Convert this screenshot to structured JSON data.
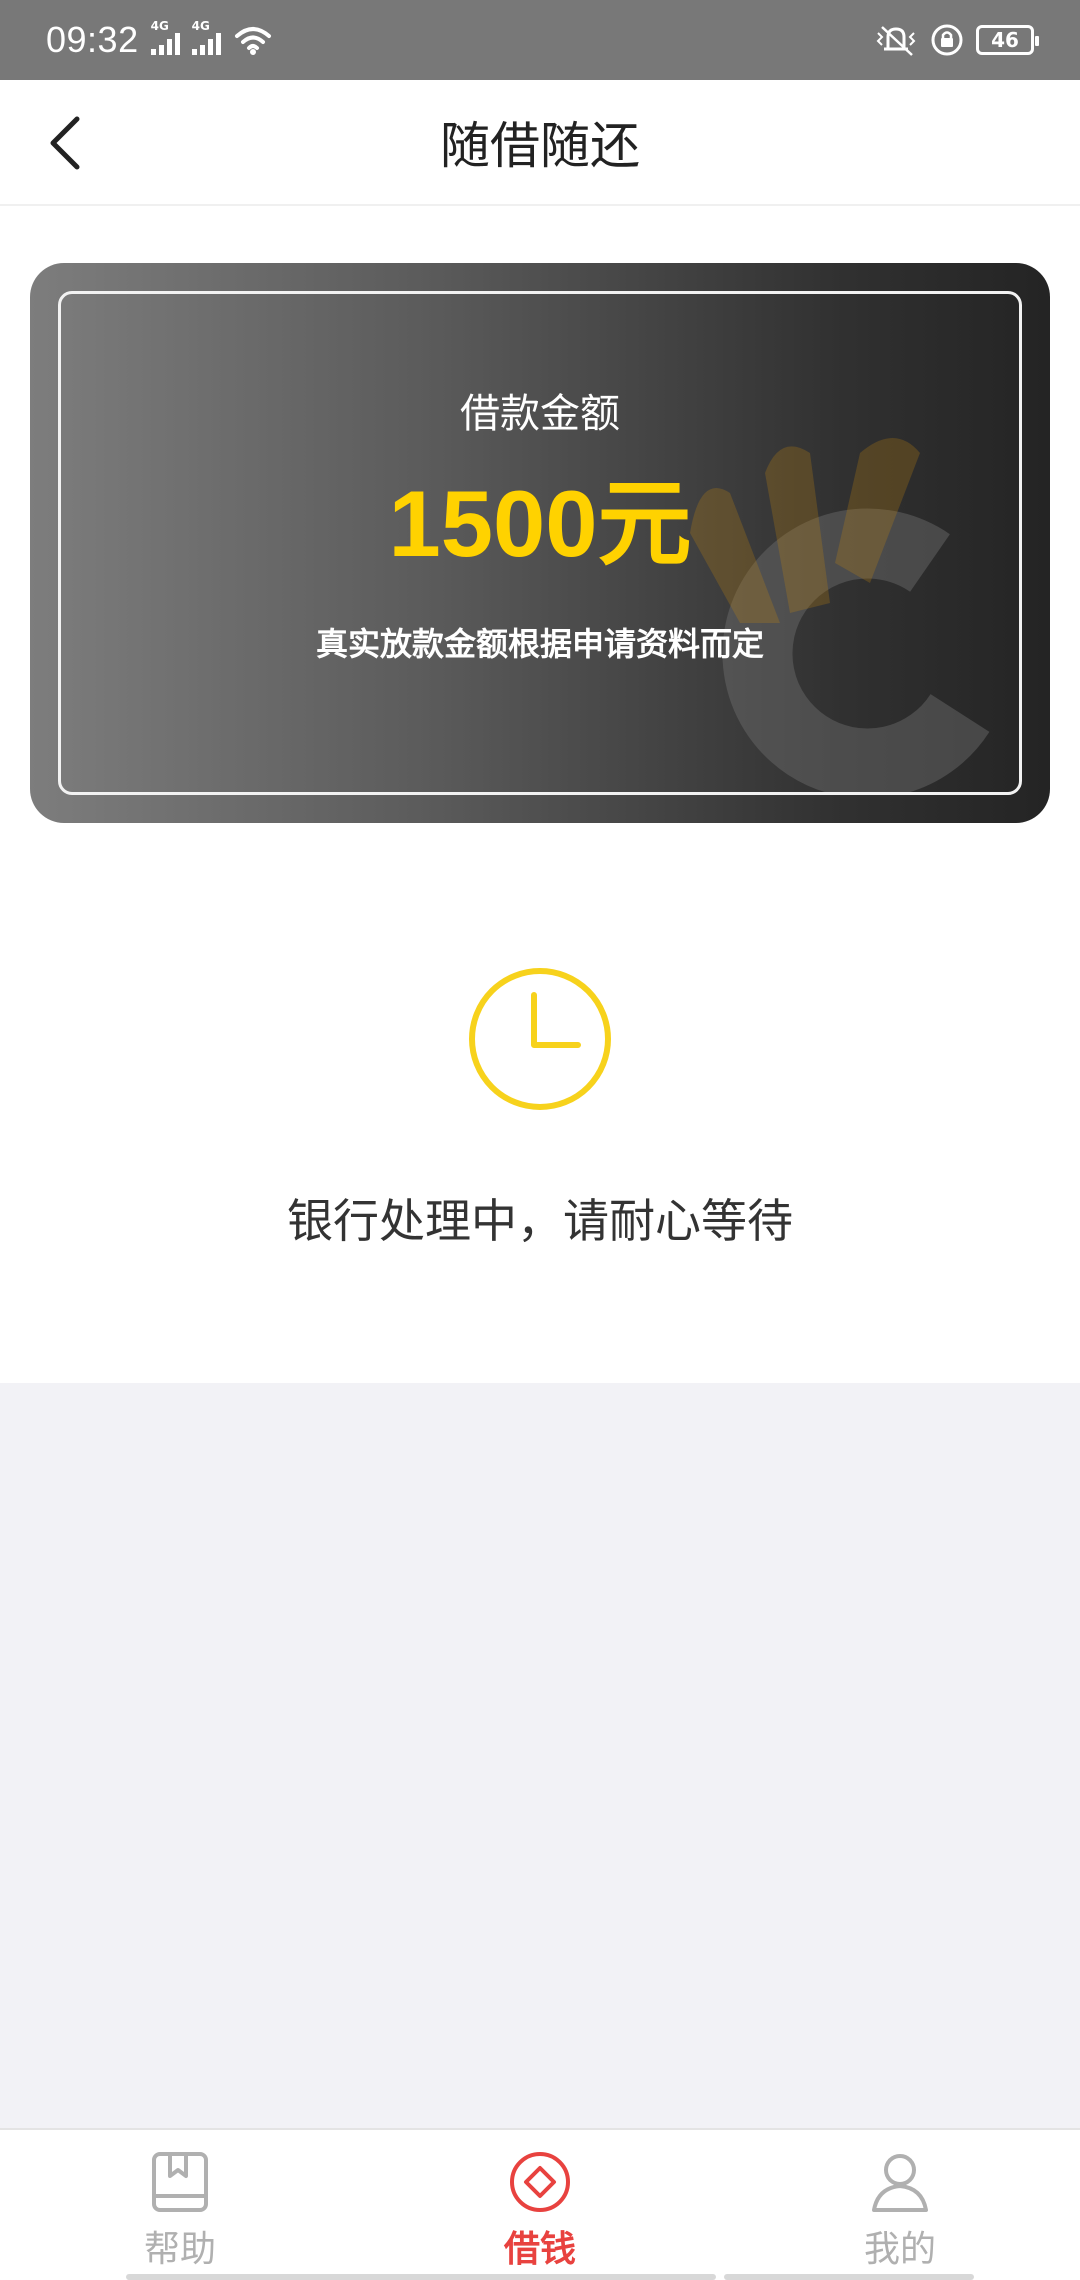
{
  "status_bar": {
    "time": "09:32",
    "signal_1_label": "4G",
    "signal_2_label": "4G",
    "battery": "46",
    "icons": [
      "wifi-icon",
      "vibrate-icon",
      "rotation-lock-icon",
      "battery-icon"
    ]
  },
  "header": {
    "title": "随借随还",
    "back_icon": "chevron-left-icon"
  },
  "loan_card": {
    "label": "借款金额",
    "amount": "1500元",
    "note": "真实放款金额根据申请资料而定",
    "accent_color": "#ffd200"
  },
  "status": {
    "icon": "clock-icon",
    "message": "银行处理中，请耐心等待",
    "icon_color": "#f7d21c"
  },
  "bottom_nav": {
    "items": [
      {
        "label": "帮助",
        "icon": "book-icon",
        "active": false
      },
      {
        "label": "借钱",
        "icon": "diamond-icon",
        "active": true
      },
      {
        "label": "我的",
        "icon": "person-icon",
        "active": false
      }
    ],
    "active_color": "#e8423f"
  }
}
